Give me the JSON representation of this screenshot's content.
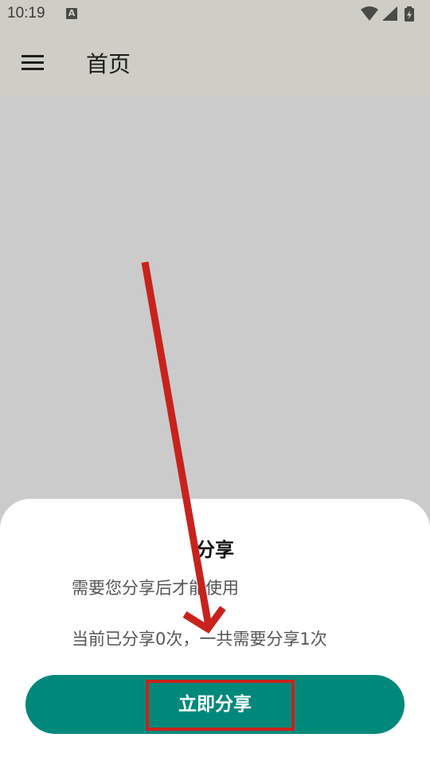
{
  "status_bar": {
    "time": "10:19",
    "notification_icon": "A",
    "icons": [
      "wifi-icon",
      "signal-icon",
      "battery-charging-icon"
    ]
  },
  "toolbar": {
    "menu_icon": "hamburger-menu-icon",
    "title": "首页"
  },
  "dialog": {
    "title": "分享",
    "message": "需要您分享后才能使用",
    "count_text": "当前已分享0次，一共需要分享1次",
    "button_label": "立即分享"
  },
  "colors": {
    "button": "#00897b",
    "annotation": "#c8221c",
    "toolbar": "#cfcec6",
    "scrim": "#cbcbcb"
  }
}
